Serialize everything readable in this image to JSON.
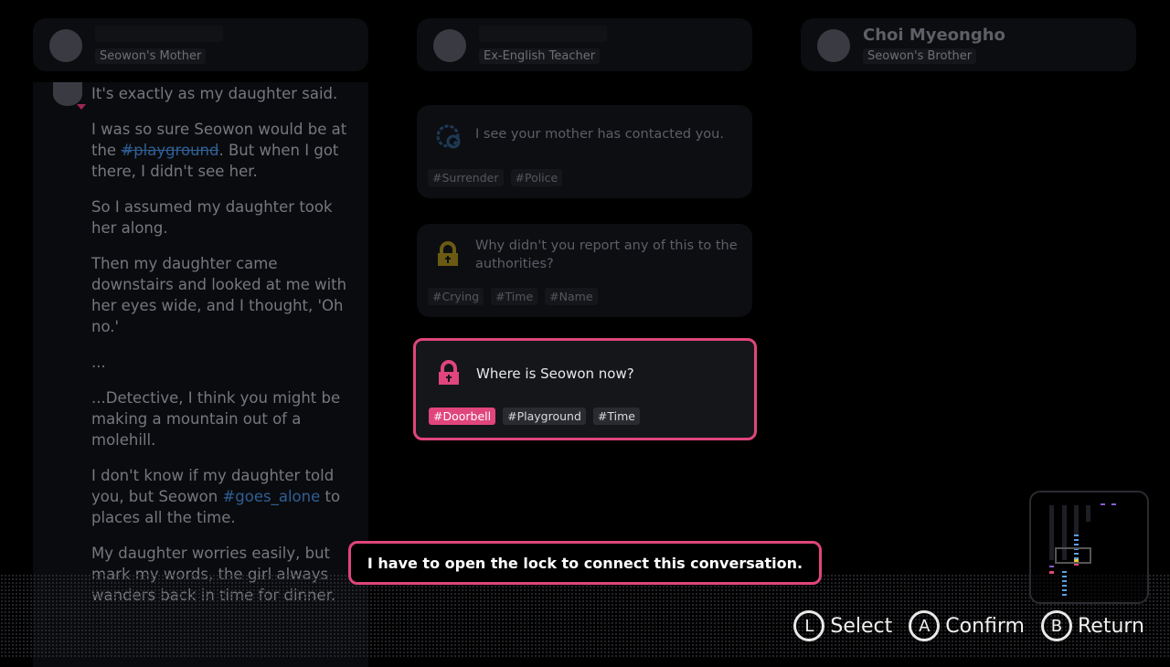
{
  "characters": [
    {
      "name": "",
      "role": "Seowon's Mother"
    },
    {
      "name": "",
      "role": "Ex-English Teacher"
    },
    {
      "name": "Choi Myeongho",
      "role": "Seowon's Brother"
    }
  ],
  "messages": {
    "m0": "It's exactly as my daughter said.",
    "m1a": "I was so sure Seowon would be at the ",
    "m1tag": "#playground",
    "m1b": ". But when I got there, I didn't see her.",
    "m2": "So I assumed my daughter took her along.",
    "m3": "Then my daughter came downstairs and looked at me with her eyes wide, and I thought, 'Oh no.'",
    "m4": "...",
    "m5": "...Detective, I think you might be making a mountain out of a molehill.",
    "m6a": "I don't know if my daughter told you, but Seowon ",
    "m6tag": "#goes_alone",
    "m6b": " to places all the time.",
    "m7": "My daughter worries easily, but mark my words, the girl always wanders back in time for dinner."
  },
  "topics": [
    {
      "question": "I see your mother has contacted you.",
      "icon": "chat-bubble-icon",
      "tags": [
        "#Surrender",
        "#Police"
      ]
    },
    {
      "question": "Why didn't you report any of this to the authorities?",
      "icon": "lock-icon",
      "tags": [
        "#Crying",
        "#Time",
        "#Name"
      ]
    },
    {
      "question": "Where is Seowon now?",
      "icon": "lock-icon",
      "tags": [
        "#Doorbell",
        "#Playground",
        "#Time"
      ],
      "selected": true
    }
  ],
  "toast": "I have to open the lock to connect this conversation.",
  "controls": [
    {
      "key": "L",
      "label": "Select"
    },
    {
      "key": "A",
      "label": "Confirm"
    },
    {
      "key": "B",
      "label": "Return"
    }
  ],
  "colors": {
    "accent": "#e0457b",
    "lock_gold": "#6b5a12",
    "chat_blue": "#1e3a55",
    "hashtag": "#2f5f95"
  }
}
